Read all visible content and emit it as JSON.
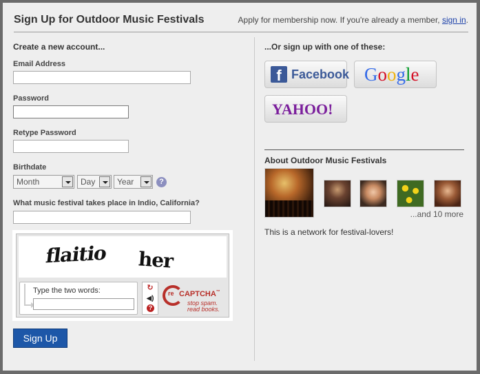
{
  "header": {
    "title": "Sign Up for Outdoor Music Festivals",
    "apply_text": "Apply for membership now. If you're already a member,",
    "sign_in": "sign in",
    "period": "."
  },
  "form": {
    "section_title": "Create a new account...",
    "email_label": "Email Address",
    "password_label": "Password",
    "retype_label": "Retype Password",
    "birthdate_label": "Birthdate",
    "month": "Month",
    "day": "Day",
    "year": "Year",
    "help_glyph": "?",
    "question_label": "What music festival takes place in Indio, California?",
    "signup_button": "Sign Up"
  },
  "captcha": {
    "word1": "flaitio",
    "word2": "her",
    "type_label": "Type the two words:",
    "brand_re": "re",
    "brand": "CAPTCHA",
    "brand_tm": "™",
    "tagline_1": "stop spam.",
    "tagline_2": "read books."
  },
  "social": {
    "title": "...Or sign up with one of these:",
    "facebook": "Facebook",
    "google": "Google",
    "yahoo": "YAHOO!"
  },
  "about": {
    "title": "About Outdoor Music Festivals",
    "more": "...and 10 more",
    "description": "This is a network for festival-lovers!"
  },
  "colors": {
    "accent_blue": "#1d57a8",
    "facebook_blue": "#3b5998",
    "yahoo_purple": "#7b1f9c",
    "recaptcha_red": "#b8302a"
  }
}
